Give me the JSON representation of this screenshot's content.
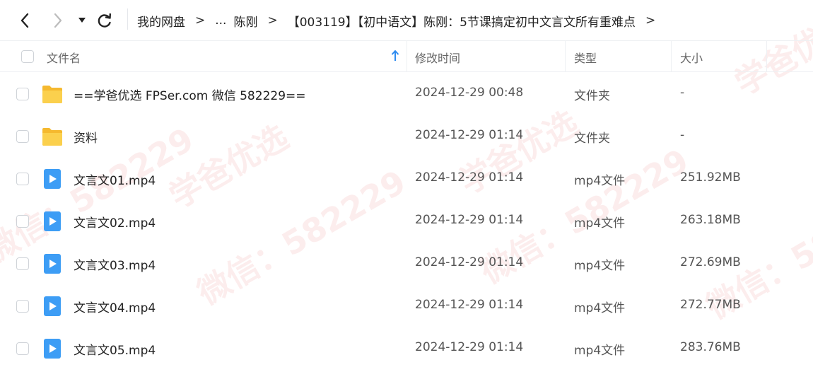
{
  "breadcrumb": {
    "items": [
      "我的网盘",
      "...",
      "陈刚",
      "【003119】【初中语文】陈刚：5节课搞定初中文言文所有重难点"
    ],
    "separator": ">"
  },
  "table": {
    "headers": {
      "name": "文件名",
      "modified": "修改时间",
      "type": "类型",
      "size": "大小"
    },
    "rows": [
      {
        "icon": "folder-icon",
        "name": "==学爸优选 FPSer.com 微信 582229==",
        "modified": "2024-12-29 00:48",
        "type": "文件夹",
        "size": "-"
      },
      {
        "icon": "folder-icon",
        "name": "资料",
        "modified": "2024-12-29 01:14",
        "type": "文件夹",
        "size": "-"
      },
      {
        "icon": "video-icon",
        "name": "文言文01.mp4",
        "modified": "2024-12-29 01:14",
        "type": "mp4文件",
        "size": "251.92MB"
      },
      {
        "icon": "video-icon",
        "name": "文言文02.mp4",
        "modified": "2024-12-29 01:14",
        "type": "mp4文件",
        "size": "263.18MB"
      },
      {
        "icon": "video-icon",
        "name": "文言文03.mp4",
        "modified": "2024-12-29 01:14",
        "type": "mp4文件",
        "size": "272.69MB"
      },
      {
        "icon": "video-icon",
        "name": "文言文04.mp4",
        "modified": "2024-12-29 01:14",
        "type": "mp4文件",
        "size": "272.77MB"
      },
      {
        "icon": "video-icon",
        "name": "文言文05.mp4",
        "modified": "2024-12-29 01:14",
        "type": "mp4文件",
        "size": "283.76MB"
      }
    ]
  },
  "watermark": {
    "text1": "学爸优选",
    "text2": "微信：582229"
  },
  "colors": {
    "folder": "#f9c53b",
    "video": "#3d9df5",
    "sort": "#2f8cf0"
  }
}
